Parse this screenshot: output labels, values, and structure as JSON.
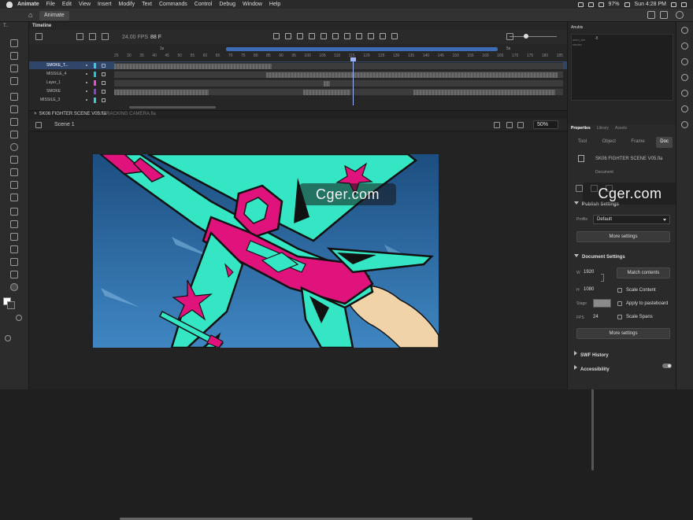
{
  "menubar": {
    "app_name": "Animate",
    "items": [
      "File",
      "Edit",
      "View",
      "Insert",
      "Modify",
      "Text",
      "Commands",
      "Control",
      "Debug",
      "Window",
      "Help"
    ],
    "battery": "97%",
    "clock": "Sun 4:28 PM"
  },
  "appbar": {
    "tab_label": "Animate"
  },
  "tools_panel": {
    "label": "T.."
  },
  "timeline": {
    "title": "Timeline",
    "fps": "24.00",
    "fps_unit": "FPS",
    "current_frame": "88",
    "frame_unit": "F",
    "ruler_marker_left": "1s",
    "ruler_marker_right": "5s",
    "ruler_numbers": [
      "25",
      "30",
      "35",
      "40",
      "45",
      "50",
      "55",
      "60",
      "65",
      "70",
      "75",
      "80",
      "85",
      "90",
      "95",
      "100",
      "105",
      "110",
      "115",
      "120",
      "125",
      "130",
      "135",
      "140",
      "145",
      "150",
      "155",
      "160",
      "165",
      "170",
      "175",
      "180",
      "185"
    ],
    "layers": [
      {
        "name": "SMOKE_T...",
        "color": "#2ad3e5"
      },
      {
        "name": "MISSILE_4",
        "color": "#18c8d8"
      },
      {
        "name": "Layer_1",
        "color": "#e64ad3"
      },
      {
        "name": "SMOKE",
        "color": "#8a3fd1"
      },
      {
        "name": "MISSILE_3",
        "color": "#3dc9d6"
      }
    ]
  },
  "doc_tabs": [
    {
      "label": "SK06 FIGHTER SCENE V05.fla",
      "active": true
    },
    {
      "label": "TRACKING CAMERA.fla",
      "active": false
    }
  ],
  "stage_bar": {
    "scene": "Scene 1",
    "zoom": "50%"
  },
  "watermark": "Cger.com",
  "anubis": {
    "title": "Anubis",
    "row1": "anim_bin",
    "row2": "smoke",
    "value1": "-8"
  },
  "properties": {
    "tabs": [
      "Properties",
      "Library",
      "Assets"
    ],
    "subtabs": [
      "Tool",
      "Object",
      "Frame",
      "Doc"
    ],
    "active_subtab": "Doc",
    "doc_name": "SK06 FIGHTER SCENE V05.fla",
    "doc_label": "Document",
    "publish_settings": {
      "title": "Publish Settings",
      "profile_label": "Profile",
      "profile_value": "Default",
      "more_button": "More settings"
    },
    "document_settings": {
      "title": "Document Settings",
      "w_label": "W",
      "w_value": "1920",
      "h_label": "H",
      "h_value": "1080",
      "match_button": "Match contents",
      "scale_content": "Scale Content",
      "stage_label": "Stage",
      "stage_color": "#8a8a8a",
      "apply_pasteboard": "Apply to pasteboard",
      "fps_label": "FPS",
      "fps_value": "24",
      "scale_spans": "Scale Spans",
      "more_button": "More settings"
    },
    "swf_history": "SWF History",
    "accessibility": "Accessibility"
  },
  "colors": {
    "teal": "#35e6c4",
    "magenta": "#e0127c",
    "sky_top": "#1d4e80",
    "sky_bottom": "#3f86c2",
    "smoke": "#f0d3a8",
    "timeline_blue": "#3b6cb5"
  }
}
